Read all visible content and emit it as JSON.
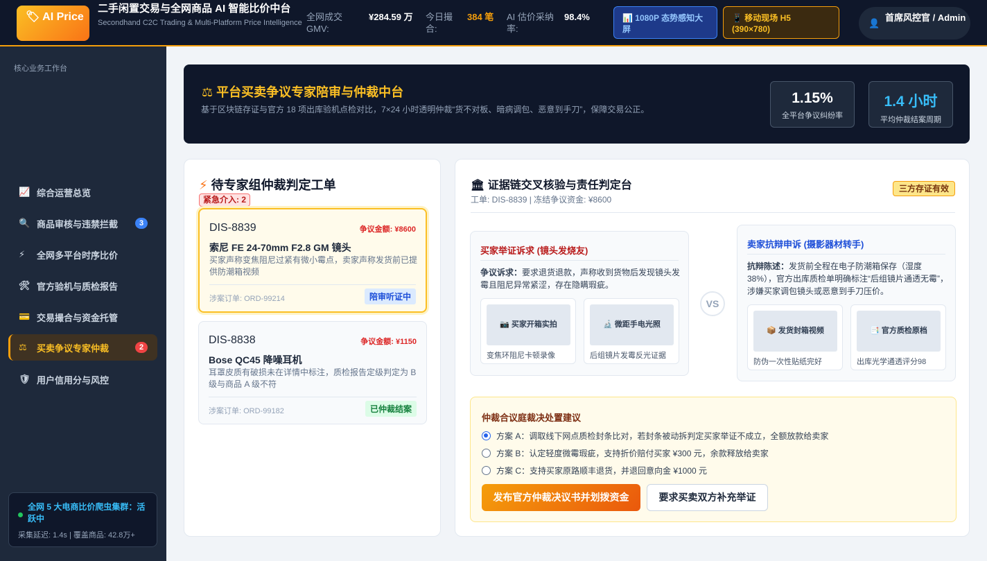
{
  "header": {
    "logo": "🏷 AI Price",
    "title": "二手闲置交易与全网商品 AI 智能比价中台",
    "subtitle": "Secondhand C2C Trading & Multi-Platform Price Intelligence",
    "stats": [
      {
        "label": "全网成交 GMV:",
        "value": "¥284.59 万"
      },
      {
        "label": "今日撮 合:",
        "value": "384 笔"
      },
      {
        "label": "AI 估价采纳 率:",
        "value": "98.4%"
      }
    ],
    "btn_screen": "📊 1080P 态势感知大屏",
    "btn_mobile": "📱 移动现场 H5 (390×780)",
    "user": "首席风控官 / Admin",
    "user_icon": "admin-avatar-icon"
  },
  "sidebar": {
    "heading": "核心业务工作台",
    "items": [
      {
        "icon": "📈",
        "label": "综合运营总览",
        "badge": ""
      },
      {
        "icon": "🔍",
        "label": "商品审核与违禁拦截",
        "badge": "3"
      },
      {
        "icon": "⚡",
        "label": "全网多平台时序比价",
        "badge": ""
      },
      {
        "icon": "🛠",
        "label": "官方验机与质检报告",
        "badge": ""
      },
      {
        "icon": "💳",
        "label": "交易撮合与资金托管",
        "badge": ""
      },
      {
        "icon": "⚖",
        "label": "买卖争议专家仲裁",
        "badge": "2"
      },
      {
        "icon": "🛡",
        "label": "用户信用分与风控",
        "badge": ""
      }
    ],
    "active_index": 5,
    "status_title": "全网 5 大电商比价爬虫集群：活跃中",
    "status_sub": "采集延迟: 1.4s | 覆盖商品: 42.8万+"
  },
  "hero": {
    "title": "⚖ 平台买卖争议专家陪审与仲裁中台",
    "desc": "基于区块链存证与官方 18 项出库验机点检对比，7×24 小时透明仲裁“货不对板、暗病调包、恶意到手刀”，保障交易公正。",
    "kpis": [
      {
        "value": "1.15%",
        "label": "全平台争议纠纷率",
        "color": "#ffffff"
      },
      {
        "value": "1.4 小时",
        "label": "平均仲裁结案周期",
        "color": "#38bdf8"
      }
    ]
  },
  "tickets": {
    "title": "待专家组仲裁判定工单",
    "title_icon": "⚡",
    "urgent": "紧急介入: 2",
    "items": [
      {
        "id": "DIS-8839",
        "amount": "争议金额: ¥8600",
        "name": "索尼 FE 24-70mm F2.8 GM 镜头",
        "desc": "买家声称变焦阻尼过紧有微小霉点，卖家声称发货前已提供防潮箱视频",
        "order": "涉案订单: ORD-99214",
        "status": "陪审听证中",
        "status_color": "#1d4ed8",
        "status_bg": "#dbeafe"
      },
      {
        "id": "DIS-8838",
        "amount": "争议金额: ¥1150",
        "name": "Bose QC45 降噪耳机",
        "desc": "耳罩皮质有破损未在详情中标注，质检报告定级判定为 B 级与商品 A 级不符",
        "order": "涉案订单: ORD-99182",
        "status": "已仲裁结案",
        "status_color": "#15803d",
        "status_bg": "#dcfce7"
      }
    ]
  },
  "evidence": {
    "title": "🏛 证据链交叉核验与责任判定台",
    "subtitle": "工单: DIS-8839 | 冻结争议资金: ¥8600",
    "cert": "三方存证有效",
    "vs": "VS",
    "buyer": {
      "title": "买家举证诉求 (镜头发烧友)",
      "label": "争议诉求：",
      "text": "要求退货退款，声称收到货物后发现镜头发霉且阻尼异常紧涩，存在隐瞒瑕疵。",
      "items": [
        {
          "img": "📷 买家开箱实拍",
          "caption": "变焦环阻尼卡顿录像"
        },
        {
          "img": "🔬 微距手电光照",
          "caption": "后组镜片发霉反光证据"
        }
      ]
    },
    "seller": {
      "title": "卖家抗辩申诉 (摄影器材转手)",
      "label": "抗辩陈述：",
      "text": "发货前全程在电子防潮箱保存（湿度38%），官方出库质检单明确标注“后组镜片通透无霉”，涉嫌买家调包镜头或恶意到手刀压价。",
      "items": [
        {
          "img": "📦 发货封箱视频",
          "caption": "防伪一次性贴纸完好"
        },
        {
          "img": "📑 官方质检原档",
          "caption": "出库光学通透评分98"
        }
      ]
    },
    "verdict": {
      "title": "仲裁合议庭裁决处置建议",
      "options": [
        "方案 A：调取线下网点质检封条比对，若封条被动拆判定买家举证不成立，全额放款给卖家",
        "方案 B：认定轻度微霉瑕疵，支持折价赔付买家 ¥300 元，余款释放给卖家",
        "方案 C：支持买家原路顺丰退货，并退回意向金 ¥1000 元"
      ],
      "selected": 0,
      "primary_btn": "发布官方仲裁决议书并划拨资金",
      "secondary_btn": "要求买卖双方补充举证"
    }
  }
}
